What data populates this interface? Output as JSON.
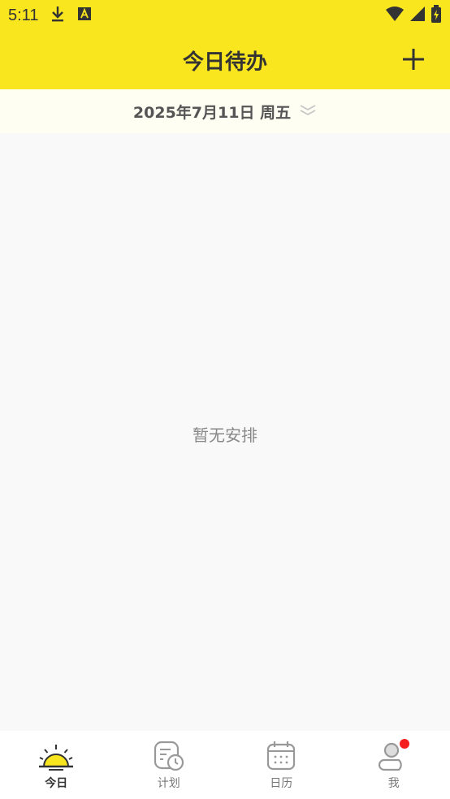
{
  "status_bar": {
    "time": "5:11",
    "icons_left": [
      "download-icon",
      "text-a-icon"
    ],
    "icons_right": [
      "wifi-icon",
      "signal-icon",
      "battery-icon"
    ]
  },
  "header": {
    "title": "今日待办",
    "add_icon": "plus-icon"
  },
  "date_bar": {
    "date": "2025年7月11日 周五",
    "expand_icon": "double-chevron-down-icon"
  },
  "content": {
    "empty_text": "暂无安排"
  },
  "tabs": [
    {
      "label": "今日",
      "icon": "sunrise-icon",
      "active": true
    },
    {
      "label": "计划",
      "icon": "plan-clock-icon",
      "active": false
    },
    {
      "label": "日历",
      "icon": "calendar-icon",
      "active": false
    },
    {
      "label": "我",
      "icon": "user-icon",
      "active": false,
      "badge": true
    }
  ],
  "colors": {
    "accent": "#f9e61f",
    "badge": "#f41e1e"
  }
}
